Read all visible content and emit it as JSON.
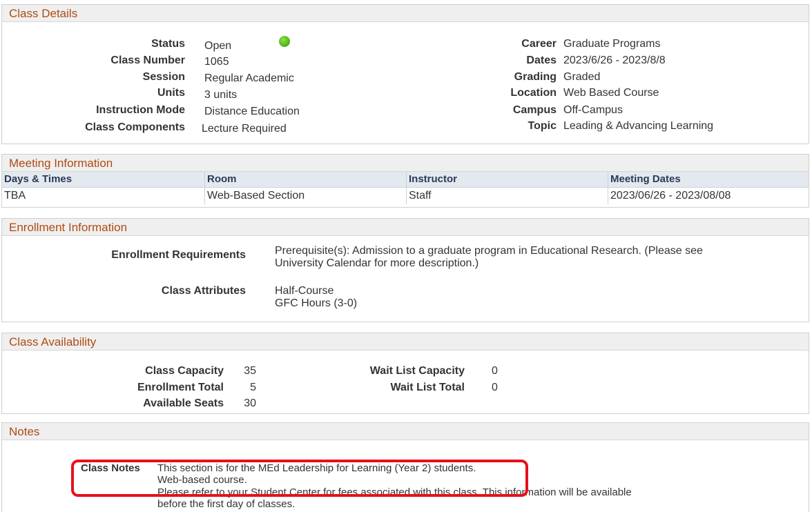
{
  "class_details": {
    "header": "Class Details",
    "status_label": "Status",
    "status_value": "Open",
    "class_number_label": "Class Number",
    "class_number_value": "1065",
    "session_label": "Session",
    "session_value": "Regular Academic",
    "units_label": "Units",
    "units_value": "3 units",
    "instruction_mode_label": "Instruction Mode",
    "instruction_mode_value": "Distance Education",
    "class_components_label": "Class Components",
    "class_components_value": "Lecture Required",
    "career_label": "Career",
    "career_value": "Graduate Programs",
    "dates_label": "Dates",
    "dates_value": "2023/6/26 - 2023/8/8",
    "grading_label": "Grading",
    "grading_value": "Graded",
    "location_label": "Location",
    "location_value": "Web Based Course",
    "campus_label": "Campus",
    "campus_value": "Off-Campus",
    "topic_label": "Topic",
    "topic_value": "Leading & Advancing Learning",
    "status_icon": "green-circle-open-status",
    "status_color": "#4fb81b"
  },
  "meeting_information": {
    "header": "Meeting Information",
    "columns": [
      "Days & Times",
      "Room",
      "Instructor",
      "Meeting Dates"
    ],
    "rows": [
      [
        "TBA",
        "Web-Based Section",
        "Staff",
        "2023/06/26 - 2023/08/08"
      ]
    ]
  },
  "enrollment_information": {
    "header": "Enrollment Information",
    "requirements_label": "Enrollment Requirements",
    "requirements_line1": "Prerequisite(s): Admission to a graduate program in Educational Research. (Please see",
    "requirements_line2": "University Calendar for more description.)",
    "attributes_label": "Class Attributes",
    "attributes": [
      "Half-Course",
      "GFC Hours (3-0)"
    ]
  },
  "class_availability": {
    "header": "Class Availability",
    "capacity_label": "Class Capacity",
    "capacity_value": "35",
    "enrollment_total_label": "Enrollment Total",
    "enrollment_total_value": "5",
    "available_seats_label": "Available Seats",
    "available_seats_value": "30",
    "waitlist_capacity_label": "Wait List Capacity",
    "waitlist_capacity_value": "0",
    "waitlist_total_label": "Wait List Total",
    "waitlist_total_value": "0"
  },
  "notes": {
    "header": "Notes",
    "class_notes_label": "Class Notes",
    "lines": [
      "This section is for the MEd Leadership for Learning (Year 2) students.",
      "Web-based course.",
      "Please refer to your Student Center for fees associated with this class.  This information will  be available",
      "before the first day of classes."
    ]
  },
  "annotation": {
    "highlight_color": "#e8101a"
  }
}
